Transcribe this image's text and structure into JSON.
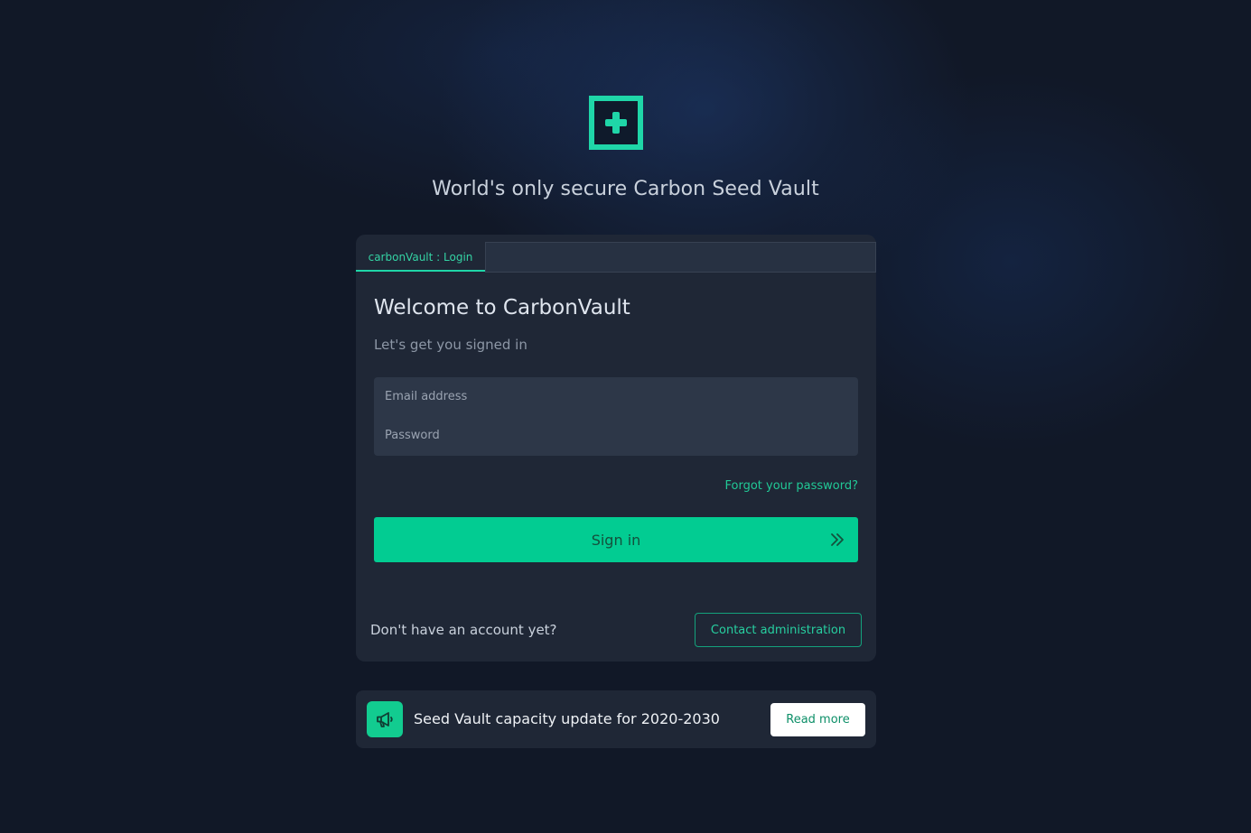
{
  "brand": {
    "logo_icon": "plus-square-icon",
    "accent_color": "#1fd6a8",
    "tagline": "World's only secure Carbon Seed Vault"
  },
  "login_card": {
    "tabs": [
      {
        "label": "carbonVault : Login",
        "active": true
      }
    ],
    "title": "Welcome to CarbonVault",
    "subtitle": "Let's get you signed in",
    "email": {
      "placeholder": "Email address",
      "value": ""
    },
    "password": {
      "placeholder": "Password",
      "value": ""
    },
    "forgot_label": "Forgot your password?",
    "signin_label": "Sign in",
    "signin_icon": "double-chevron-right-icon",
    "signin_color": "#02cc92",
    "no_account_label": "Don't have an account yet?",
    "contact_label": "Contact administration"
  },
  "announcement": {
    "icon": "megaphone-icon",
    "text": "Seed Vault capacity update for 2020-2030",
    "read_more_label": "Read more"
  }
}
